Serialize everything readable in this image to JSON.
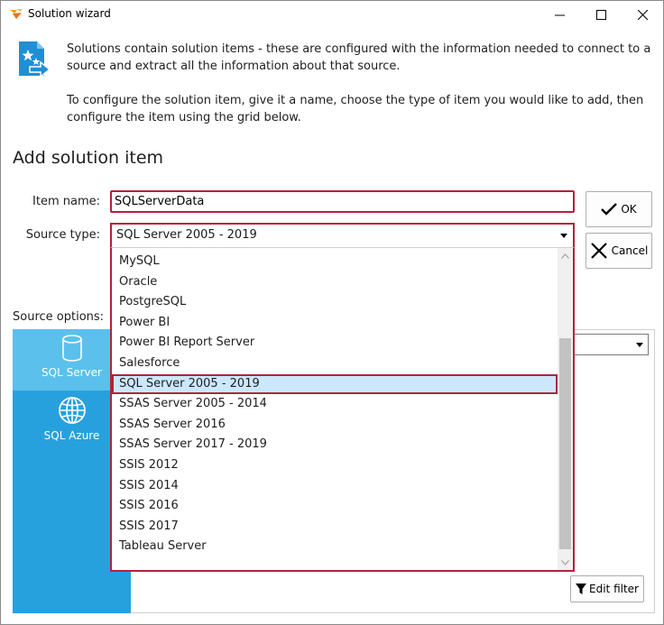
{
  "window": {
    "title": "Solution wizard"
  },
  "info": {
    "paragraph1": "Solutions contain solution items - these are configured with the information needed to connect to a source and extract all the information about that source.",
    "paragraph2": "To configure the solution item, give it a name, choose the type of item you would like to add, then configure the item using the grid below."
  },
  "form": {
    "section_title": "Add solution item",
    "item_name_label": "Item name:",
    "item_name_value": "SQLServerData",
    "source_type_label": "Source type:",
    "source_type_value": "SQL Server 2005 - 2019",
    "source_options_label": "Source options:"
  },
  "buttons": {
    "ok": "OK",
    "cancel": "Cancel",
    "edit_filter": "Edit filter"
  },
  "source_tiles": [
    {
      "label": "SQL Server",
      "icon": "database-icon",
      "active": true
    },
    {
      "label": "SQL Azure",
      "icon": "globe-icon",
      "active": false
    }
  ],
  "dropdown": {
    "items": [
      "MySQL",
      "Oracle",
      "PostgreSQL",
      "Power BI",
      "Power BI Report Server",
      "Salesforce",
      "SQL Server 2005 - 2019",
      "SSAS Server 2005 - 2014",
      "SSAS Server 2016",
      "SSAS Server 2017 - 2019",
      "SSIS 2012",
      "SSIS 2014",
      "SSIS 2016",
      "SSIS 2017",
      "Tableau Server"
    ],
    "selected_index": 6
  },
  "colors": {
    "accent_red": "#b5213c",
    "panel_blue": "#27a1dd",
    "tile_active": "#5bc0ec",
    "selection": "#cce8ff"
  }
}
